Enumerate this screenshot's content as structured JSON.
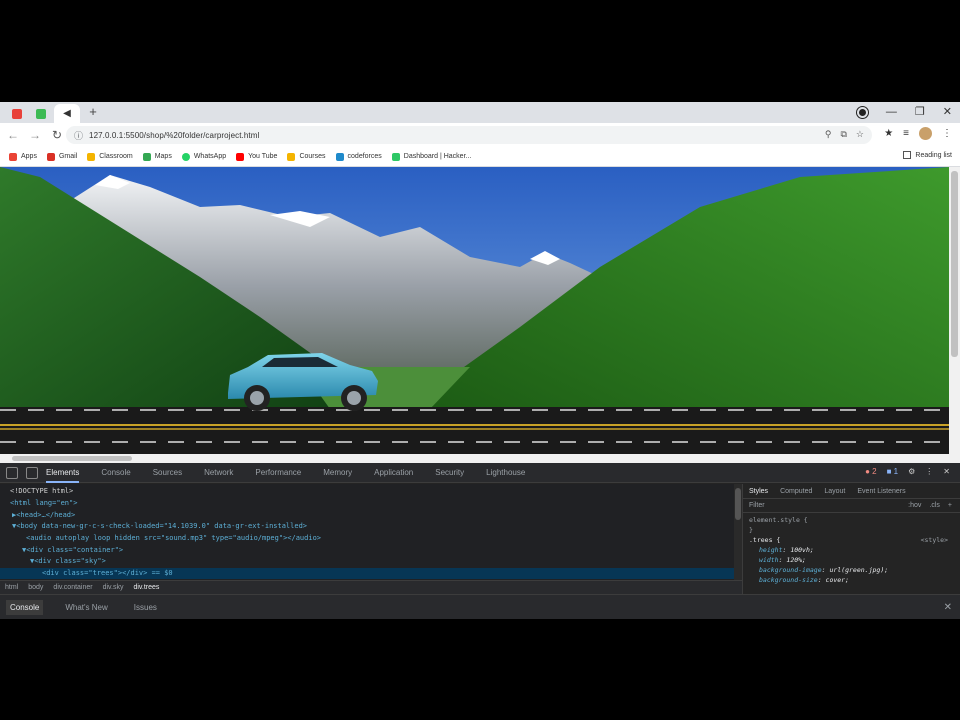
{
  "tabs": [
    {
      "name": "tab-1",
      "color": "#e8413a"
    },
    {
      "name": "tab-2",
      "color": "#3cba54"
    },
    {
      "name": "tab-active",
      "icon": "back-arrow-icon"
    }
  ],
  "toolbar": {
    "url": "127.0.0.1:5500/shop/%20folder/carproject.html"
  },
  "bookmarks": [
    {
      "label": "Apps",
      "color": "#ea4335"
    },
    {
      "label": "Gmail",
      "color": "#d93025"
    },
    {
      "label": "Classroom",
      "color": "#f4b400"
    },
    {
      "label": "Maps",
      "color": "#34a853"
    },
    {
      "label": "WhatsApp",
      "color": "#25d366"
    },
    {
      "label": "You Tube",
      "color": "#ff0000"
    },
    {
      "label": "Courses",
      "color": "#f4b400"
    },
    {
      "label": "codeforces",
      "color": "#1f8acb"
    },
    {
      "label": "Dashboard | Hacker...",
      "color": "#2ec866"
    }
  ],
  "reading_list": "Reading list",
  "devtools": {
    "tabs": [
      "Elements",
      "Console",
      "Sources",
      "Network",
      "Performance",
      "Memory",
      "Application",
      "Security",
      "Lighthouse"
    ],
    "errors": "2",
    "infos": "1",
    "elements_lines": [
      "<!DOCTYPE html>",
      "<html lang=\"en\">",
      "▶<head>…</head>",
      "▼<body data-new-gr-c-s-check-loaded=\"14.1039.0\" data-gr-ext-installed>",
      "<audio autoplay loop hidden src=\"sound.mp3\" type=\"audio/mpeg\"></audio>",
      "▼<div class=\"container\">",
      "▼<div class=\"sky\">",
      "<div class=\"trees\"></div> == $0"
    ],
    "breadcrumbs": [
      "html",
      "body",
      "div.container",
      "div.sky",
      "div.trees"
    ],
    "styles_tabs": [
      "Styles",
      "Computed",
      "Layout",
      "Event Listeners"
    ],
    "filter_placeholder": "Filter",
    "filter_opts": [
      ":hov",
      ".cls",
      "+"
    ],
    "element_style": "element.style {",
    "element_style_close": "}",
    "rule_selector": ".trees {",
    "rule_source": "<style>",
    "rule_props": [
      {
        "name": "height",
        "value": "100vh;"
      },
      {
        "name": "width",
        "value": "120%;"
      },
      {
        "name": "background-image",
        "value": "url(green.jpg);"
      },
      {
        "name": "background-size",
        "value": "cover;"
      }
    ],
    "drawer_tabs": [
      "Console",
      "What's New",
      "Issues"
    ]
  }
}
